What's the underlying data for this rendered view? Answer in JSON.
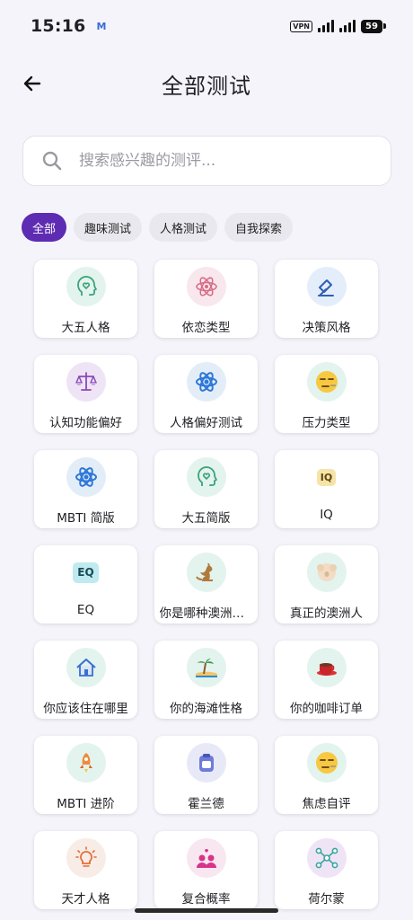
{
  "status_bar": {
    "time": "15:16",
    "notification_icon": "M",
    "vpn_label": "VPN",
    "battery": "59"
  },
  "header": {
    "title": "全部测试",
    "back_icon": "arrow-left-icon"
  },
  "search": {
    "placeholder": "搜索感兴趣的测评..."
  },
  "tabs": [
    {
      "label": "全部",
      "active": true
    },
    {
      "label": "趣味测试",
      "active": false
    },
    {
      "label": "人格测试",
      "active": false
    },
    {
      "label": "自我探索",
      "active": false
    }
  ],
  "colors": {
    "accent": "#5e2bb3",
    "background": "#f4f4fa"
  },
  "tests": [
    {
      "label": "大五人格",
      "icon": "head-heart-icon",
      "bg": "#e3f3ee"
    },
    {
      "label": "依恋类型",
      "icon": "atom-icon",
      "bg": "#f8e7ec"
    },
    {
      "label": "决策风格",
      "icon": "gavel-icon",
      "bg": "#e4eefa"
    },
    {
      "label": "认知功能偏好",
      "icon": "scales-icon",
      "bg": "#efe4f6"
    },
    {
      "label": "人格偏好测试",
      "icon": "atom-blue-icon",
      "bg": "#e3edf8"
    },
    {
      "label": "压力类型",
      "icon": "stressed-face-icon",
      "bg": "#e3f3ee"
    },
    {
      "label": "MBTI 简版",
      "icon": "atom-blue-icon",
      "bg": "#e3edf8"
    },
    {
      "label": "大五简版",
      "icon": "head-heart-icon",
      "bg": "#e3f3ee"
    },
    {
      "label": "IQ",
      "icon": "iq-text-icon",
      "text": "IQ",
      "bg": "#ffffff"
    },
    {
      "label": "EQ",
      "icon": "eq-text-icon",
      "text": "EQ",
      "bg": "#ffffff"
    },
    {
      "label": "你是哪种澳洲动物",
      "icon": "kangaroo-icon",
      "bg": "#e3f3ee"
    },
    {
      "label": "真正的澳洲人",
      "icon": "koala-icon",
      "bg": "#e3f3ee"
    },
    {
      "label": "你应该住在哪里",
      "icon": "house-icon",
      "bg": "#e3f3ee"
    },
    {
      "label": "你的海滩性格",
      "icon": "beach-icon",
      "bg": "#e3f3ee"
    },
    {
      "label": "你的咖啡订单",
      "icon": "coffee-cup-icon",
      "bg": "#e3f3ee"
    },
    {
      "label": "MBTI 进阶",
      "icon": "rocket-icon",
      "bg": "#e3f3ee"
    },
    {
      "label": "霍兰德",
      "icon": "clipboard-icon",
      "bg": "#e8e9f7"
    },
    {
      "label": "焦虑自评",
      "icon": "stressed-face-icon",
      "bg": "#e3f3ee"
    },
    {
      "label": "天才人格",
      "icon": "lightbulb-icon",
      "bg": "#f8ece6"
    },
    {
      "label": "复合概率",
      "icon": "couple-icon",
      "bg": "#f8e7f1"
    },
    {
      "label": "荷尔蒙",
      "icon": "molecule-icon",
      "bg": "#efe4f6"
    }
  ]
}
